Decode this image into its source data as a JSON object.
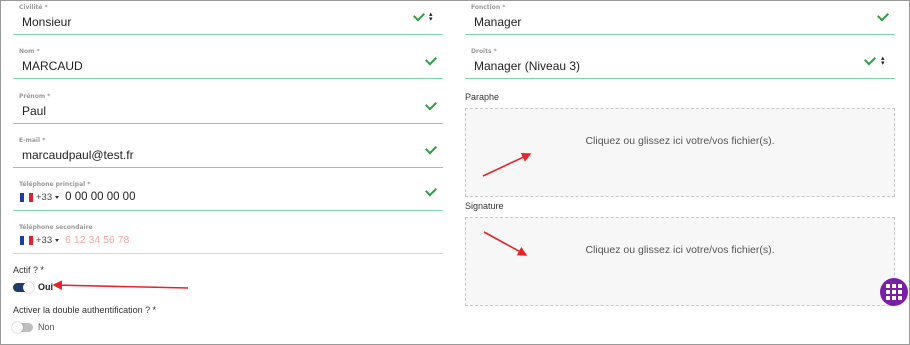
{
  "left": {
    "civilite": {
      "label": "Civilité *",
      "value": "Monsieur"
    },
    "nom": {
      "label": "Nom *",
      "value": "MARCAUD"
    },
    "prenom": {
      "label": "Prénom *",
      "value": "Paul"
    },
    "email": {
      "label": "E-mail *",
      "value": "marcaudpaul@test.fr"
    },
    "tel_principal": {
      "label": "Téléphone principal *",
      "code": "+33",
      "value": "0 00 00 00 00"
    },
    "tel_secondaire": {
      "label": "Téléphone secondaire",
      "code": "+33",
      "placeholder": "6 12 34 56 78"
    },
    "actif": {
      "label": "Actif ? *",
      "state": "Oui"
    },
    "double_auth": {
      "label": "Activer la double authentification ? *",
      "state": "Non"
    }
  },
  "right": {
    "fonction": {
      "label": "Fonction *",
      "value": "Manager"
    },
    "droits": {
      "label": "Droits *",
      "value": "Manager (Niveau 3)"
    },
    "paraphe": {
      "label": "Paraphe",
      "drop_text": "Cliquez ou glissez ici votre/vos fichier(s)."
    },
    "signature": {
      "label": "Signature",
      "drop_text": "Cliquez ou glissez ici votre/vos fichier(s)."
    }
  },
  "icons": {
    "valid": "check-icon",
    "select": "up-down-chevron-icon",
    "flag": "france-flag-icon",
    "fab": "grid-menu-icon",
    "annotation": "red-arrow-icon"
  },
  "colors": {
    "accent_underline": "#7fd1b0",
    "valid_check": "#2e9f45",
    "toggle_on": "#1f3a6a",
    "toggle_off": "#bdbdbd",
    "fab": "#7c1fa8",
    "annotation_arrow": "#e3262b"
  }
}
